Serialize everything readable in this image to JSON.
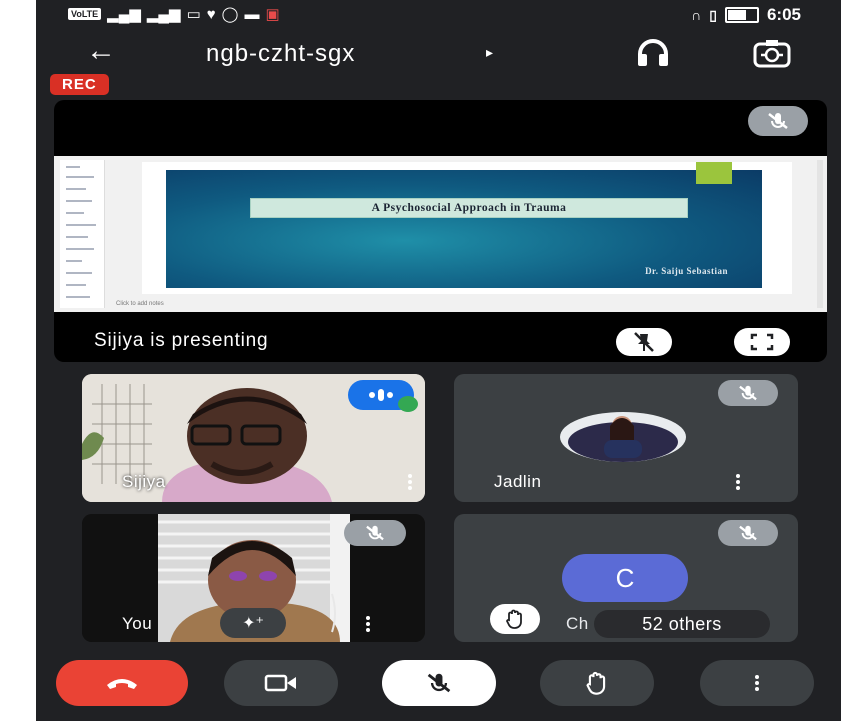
{
  "statusbar": {
    "carrier_badge": "VoLTE",
    "time": "6:05",
    "signal_icons": [
      "signal-icon",
      "wifi-icon",
      "battery-icon"
    ]
  },
  "toolbar": {
    "meeting_code": "ngb-czht-sgx",
    "expand_arrow": "▸",
    "back_icon": "←"
  },
  "recording_badge": "REC",
  "presentation": {
    "slide_title": "A Psychosocial Approach in Trauma",
    "slide_author": "Dr. Saiju Sebastian",
    "slide_notes_hint": "Click to add notes",
    "presenting_label": "Sijiya is presenting"
  },
  "participants": [
    {
      "name": "Sijiya",
      "video": true,
      "muted": false
    },
    {
      "name": "Jadlin",
      "video": false,
      "muted": true
    },
    {
      "name": "You",
      "video": true,
      "muted": true
    },
    {
      "name": "Ch",
      "initial": "C",
      "video": false,
      "muted": true,
      "others_label": "52 others"
    }
  ],
  "colors": {
    "background": "#202124",
    "tile": "#3c4043",
    "end_call": "#ea4335",
    "rec": "#d93025",
    "avatar": "#5b6bd6"
  },
  "controls": [
    "end-call",
    "camera",
    "microphone",
    "raise-hand",
    "more-options"
  ]
}
